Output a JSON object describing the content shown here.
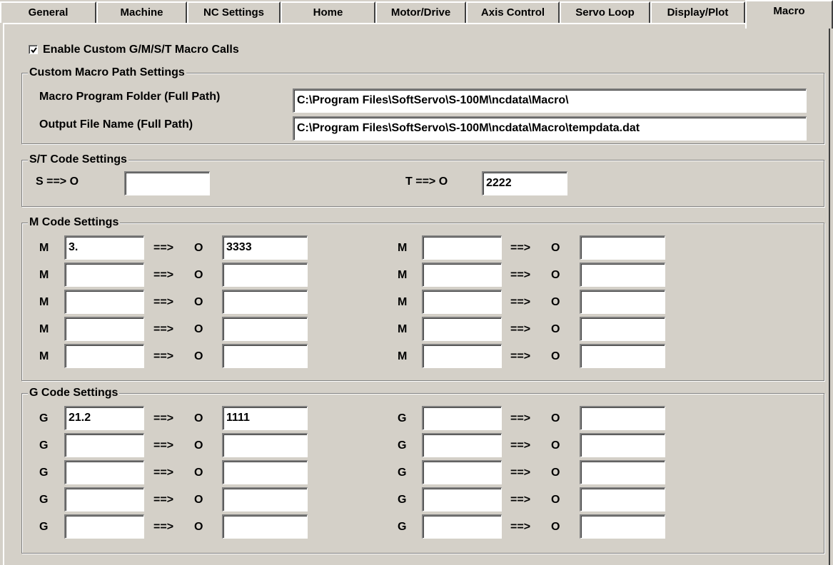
{
  "tabs": [
    "General",
    "Machine",
    "NC Settings",
    "Home",
    "Motor/Drive",
    "Axis Control",
    "Servo Loop",
    "Display/Plot",
    "Macro"
  ],
  "enable_checkbox": {
    "label": "Enable Custom G/M/S/T Macro Calls",
    "checked": true
  },
  "path_group": {
    "title": "Custom Macro Path Settings",
    "folder_label": "Macro Program Folder (Full Path)",
    "folder_value": "C:\\Program Files\\SoftServo\\S-100M\\ncdata\\Macro\\",
    "output_label": "Output File Name (Full Path)",
    "output_value": "C:\\Program Files\\SoftServo\\S-100M\\ncdata\\Macro\\tempdata.dat"
  },
  "st_group": {
    "title": "S/T Code Settings",
    "s_label": "S ==> O",
    "s_value": "",
    "t_label": "T ==> O",
    "t_value": "2222"
  },
  "m_group": {
    "title": "M Code Settings",
    "code": "M",
    "arrow": "==>",
    "o": "O",
    "rows": [
      {
        "left_code": "3.",
        "left_o": "3333",
        "right_code": "",
        "right_o": ""
      },
      {
        "left_code": "",
        "left_o": "",
        "right_code": "",
        "right_o": ""
      },
      {
        "left_code": "",
        "left_o": "",
        "right_code": "",
        "right_o": ""
      },
      {
        "left_code": "",
        "left_o": "",
        "right_code": "",
        "right_o": ""
      },
      {
        "left_code": "",
        "left_o": "",
        "right_code": "",
        "right_o": ""
      }
    ]
  },
  "g_group": {
    "title": "G Code Settings",
    "code": "G",
    "arrow": "==>",
    "o": "O",
    "rows": [
      {
        "left_code": "21.2",
        "left_o": "1111",
        "right_code": "",
        "right_o": ""
      },
      {
        "left_code": "",
        "left_o": "",
        "right_code": "",
        "right_o": ""
      },
      {
        "left_code": "",
        "left_o": "",
        "right_code": "",
        "right_o": ""
      },
      {
        "left_code": "",
        "left_o": "",
        "right_code": "",
        "right_o": ""
      },
      {
        "left_code": "",
        "left_o": "",
        "right_code": "",
        "right_o": ""
      }
    ]
  }
}
